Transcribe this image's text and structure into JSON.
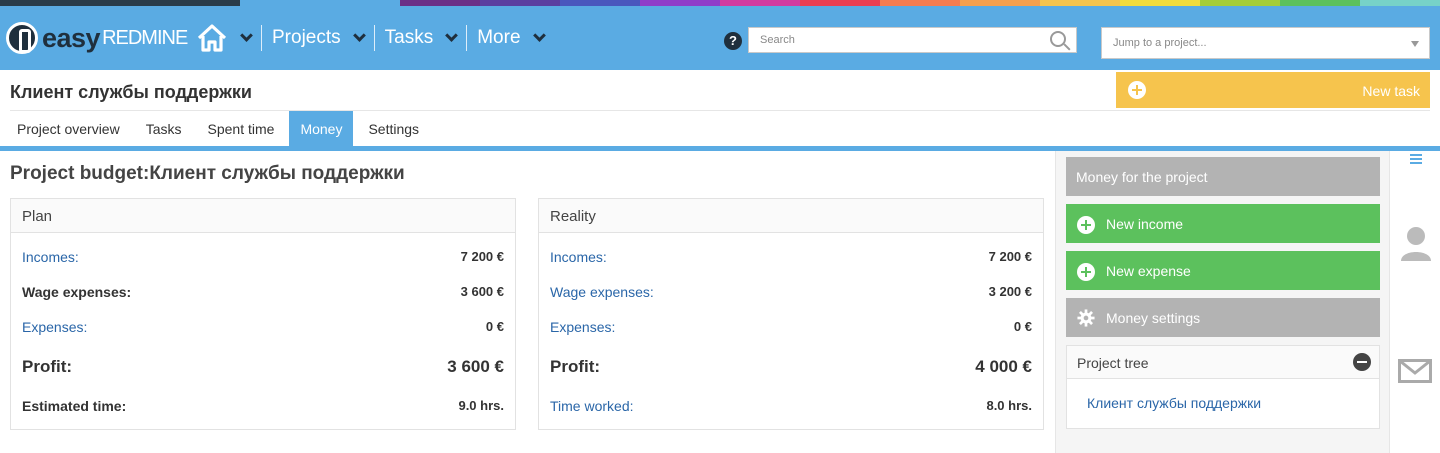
{
  "colors": {
    "strip": [
      "#2a3c4a",
      "#2a3c4a",
      "#2a3c4a",
      "#5aabe3",
      "#5aabe3",
      "#6b2f87",
      "#5b3fa0",
      "#4a57bd",
      "#8f3dc9",
      "#d23aa0",
      "#ea3f52",
      "#f47c50",
      "#f6a04d",
      "#f6c44d",
      "#f1dc3c",
      "#a4cd39",
      "#5cc15d",
      "#77d2c8"
    ],
    "topbar": "#5aabe3",
    "accent_yellow": "#f6c44d",
    "accent_green": "#5cc15d",
    "link": "#2a66a8"
  },
  "header": {
    "logo_easy": "easy",
    "logo_redmine": "REDMINE",
    "nav": [
      "Projects",
      "Tasks",
      "More"
    ],
    "search_placeholder": "Search",
    "jump_placeholder": "Jump to a project...",
    "help": "?"
  },
  "project": {
    "title": "Клиент службы поддержки",
    "new_task": "New task"
  },
  "tabs": [
    {
      "label": "Project overview"
    },
    {
      "label": "Tasks"
    },
    {
      "label": "Spent time"
    },
    {
      "label": "Money",
      "active": true
    },
    {
      "label": "Settings"
    }
  ],
  "main": {
    "heading": "Project budget:Клиент службы поддержки",
    "plan": {
      "title": "Plan",
      "incomes_label": "Incomes:",
      "incomes_value": "7 200 €",
      "wage_label": "Wage expenses:",
      "wage_value": "3 600 €",
      "expenses_label": "Expenses:",
      "expenses_value": "0 €",
      "profit_label": "Profit:",
      "profit_value": "3 600 €",
      "time_label": "Estimated time:",
      "time_value": "9.0 hrs."
    },
    "reality": {
      "title": "Reality",
      "incomes_label": "Incomes:",
      "incomes_value": "7 200 €",
      "wage_label": "Wage expenses:",
      "wage_value": "3 200 €",
      "expenses_label": "Expenses:",
      "expenses_value": "0 €",
      "profit_label": "Profit:",
      "profit_value": "4 000 €",
      "time_label": "Time worked:",
      "time_value": "8.0 hrs."
    }
  },
  "sidebar": {
    "money_for_project": "Money for the project",
    "new_income": "New income",
    "new_expense": "New expense",
    "money_settings": "Money settings",
    "project_tree": "Project tree",
    "tree_item": "Клиент службы поддержки"
  }
}
